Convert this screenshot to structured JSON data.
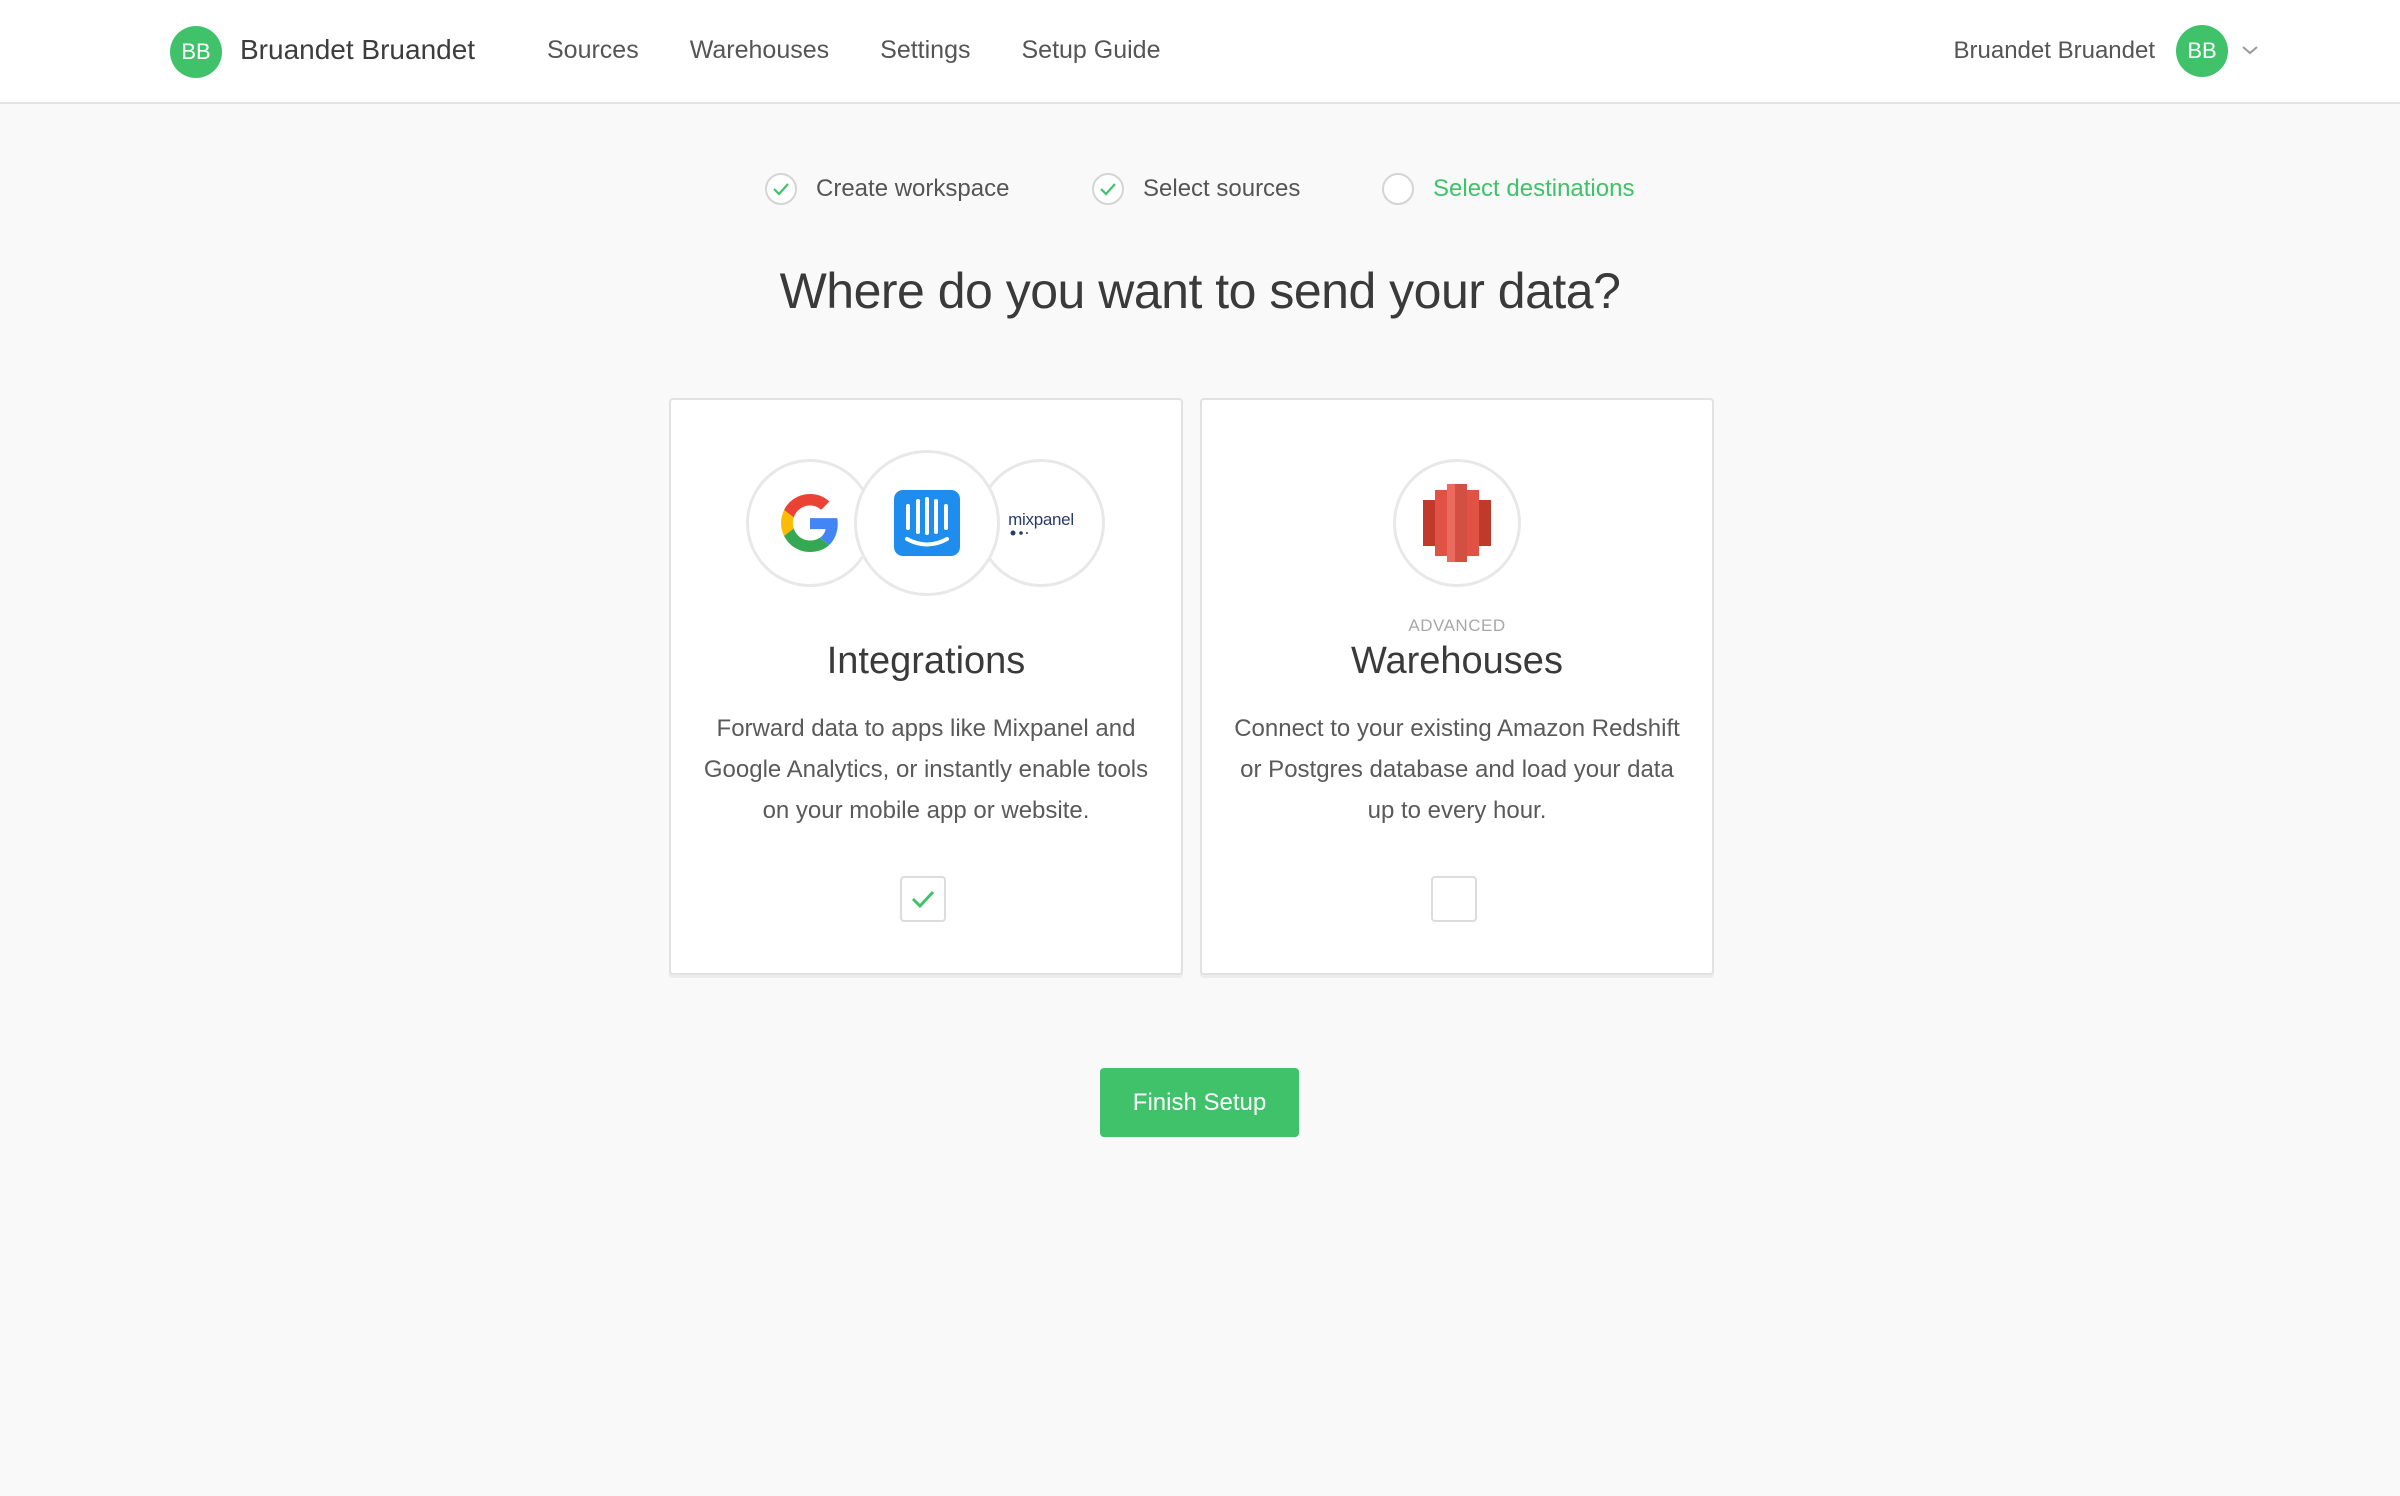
{
  "header": {
    "workspace_initials": "BB",
    "workspace_name": "Bruandet Bruandet",
    "nav": [
      "Sources",
      "Warehouses",
      "Settings",
      "Setup Guide"
    ],
    "user_name": "Bruandet Bruandet",
    "user_initials": "BB"
  },
  "steps": [
    {
      "label": "Create workspace",
      "done": true
    },
    {
      "label": "Select sources",
      "done": true
    },
    {
      "label": "Select destinations",
      "done": false,
      "active": true
    }
  ],
  "heading": "Where do you want to send your data?",
  "cards": {
    "integrations": {
      "title": "Integrations",
      "description": "Forward data to apps like Mixpanel and Google Analytics, or instantly enable tools on your mobile app or website.",
      "checked": true,
      "logos": [
        "google-icon",
        "intercom-icon",
        "mixpanel-logo"
      ],
      "mixpanel_text": "mixpanel"
    },
    "warehouses": {
      "eyebrow": "ADVANCED",
      "title": "Warehouses",
      "description": "Connect to your existing Amazon Redshift or Postgres database and load your data up to every hour.",
      "checked": false,
      "logos": [
        "redshift-icon"
      ]
    }
  },
  "finish_label": "Finish Setup",
  "colors": {
    "accent": "#3fc26a",
    "page_bg": "#f9f9f9",
    "intercom_blue": "#1f8ded",
    "redshift_red": "#e05243"
  }
}
